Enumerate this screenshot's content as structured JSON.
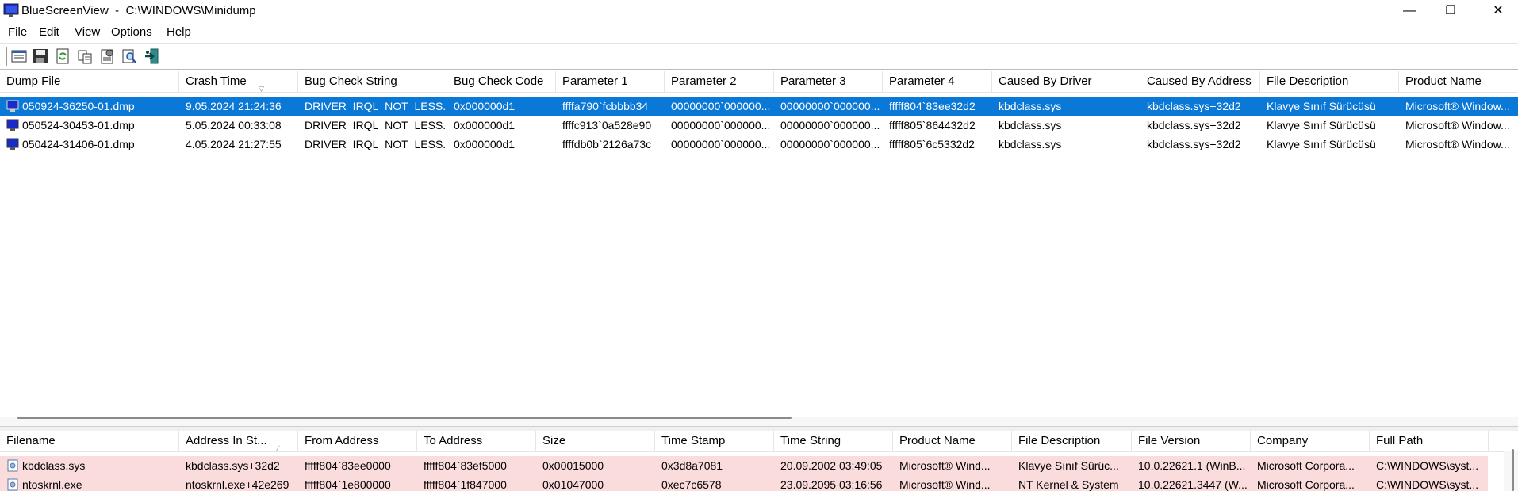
{
  "window": {
    "title": "BlueScreenView  -  C:\\WINDOWS\\Minidump",
    "minimize": "—",
    "restore": "❐",
    "close": "✕"
  },
  "menu": [
    "File",
    "Edit",
    "View",
    "Options",
    "Help"
  ],
  "toolbar": [
    "properties-icon",
    "save-icon",
    "refresh-icon",
    "copy-icon",
    "options-icon",
    "find-icon",
    "exit-icon"
  ],
  "dumps": {
    "columns": [
      "Dump File",
      "Crash Time",
      "Bug Check String",
      "Bug Check Code",
      "Parameter 1",
      "Parameter 2",
      "Parameter 3",
      "Parameter 4",
      "Caused By Driver",
      "Caused By Address",
      "File Description",
      "Product Name"
    ],
    "rows": [
      [
        "050924-36250-01.dmp",
        "9.05.2024 21:24:36",
        "DRIVER_IRQL_NOT_LESS...",
        "0x000000d1",
        "ffffa790`fcbbbb34",
        "00000000`000000...",
        "00000000`000000...",
        "fffff804`83ee32d2",
        "kbdclass.sys",
        "kbdclass.sys+32d2",
        "Klavye Sınıf Sürücüsü",
        "Microsoft® Window..."
      ],
      [
        "050524-30453-01.dmp",
        "5.05.2024 00:33:08",
        "DRIVER_IRQL_NOT_LESS...",
        "0x000000d1",
        "ffffc913`0a528e90",
        "00000000`000000...",
        "00000000`000000...",
        "fffff805`864432d2",
        "kbdclass.sys",
        "kbdclass.sys+32d2",
        "Klavye Sınıf Sürücüsü",
        "Microsoft® Window..."
      ],
      [
        "050424-31406-01.dmp",
        "4.05.2024 21:27:55",
        "DRIVER_IRQL_NOT_LESS...",
        "0x000000d1",
        "ffffdb0b`2126a73c",
        "00000000`000000...",
        "00000000`000000...",
        "fffff805`6c5332d2",
        "kbdclass.sys",
        "kbdclass.sys+32d2",
        "Klavye Sınıf Sürücüsü",
        "Microsoft® Window..."
      ]
    ],
    "selected_row": 0
  },
  "drivers": {
    "columns": [
      "Filename",
      "Address In St...",
      "From Address",
      "To Address",
      "Size",
      "Time Stamp",
      "Time String",
      "Product Name",
      "File Description",
      "File Version",
      "Company",
      "Full Path"
    ],
    "rows": [
      [
        "kbdclass.sys",
        "kbdclass.sys+32d2",
        "fffff804`83ee0000",
        "fffff804`83ef5000",
        "0x00015000",
        "0x3d8a7081",
        "20.09.2002 03:49:05",
        "Microsoft® Wind...",
        "Klavye Sınıf Sürüc...",
        "10.0.22621.1 (WinB...",
        "Microsoft Corpora...",
        "C:\\WINDOWS\\syst..."
      ],
      [
        "ntoskrnl.exe",
        "ntoskrnl.exe+42e269",
        "fffff804`1e800000",
        "fffff804`1f847000",
        "0x01047000",
        "0xec7c6578",
        "23.09.2095 03:16:56",
        "Microsoft® Wind...",
        "NT Kernel & System",
        "10.0.22621.3447 (W...",
        "Microsoft Corpora...",
        "C:\\WINDOWS\\syst..."
      ]
    ]
  },
  "colors": {
    "selection": "#0a78d7",
    "highlight_row": "#fbdcdc"
  }
}
